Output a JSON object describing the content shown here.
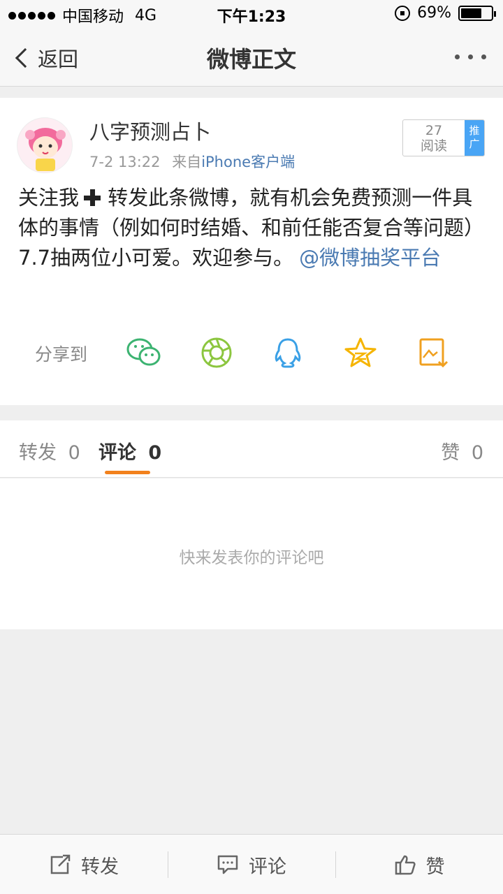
{
  "status_bar": {
    "carrier": "中国移动",
    "network": "4G",
    "time": "下午1:23",
    "battery": "69%",
    "battery_level": 0.69
  },
  "nav": {
    "back_label": "返回",
    "title": "微博正文"
  },
  "post": {
    "author": "八字预测占卜",
    "date": "7-2 13:22",
    "source_prefix": "来自",
    "source": "iPhone客户端",
    "read_count": "27",
    "read_label": "阅读",
    "promo_label": "推广",
    "text_part1": "关注我",
    "text_part2": " 转发此条微博，就有机会免费预测一件具体的事情（例如何时结婚、和前任能否复合等问题）7.7抽两位小可爱。欢迎参与。",
    "mention": "@微博抽奖平台"
  },
  "share": {
    "label": "分享到",
    "icons": [
      "wechat-icon",
      "moments-icon",
      "qq-icon",
      "qzone-icon",
      "save-image-icon"
    ],
    "colors": {
      "wechat": "#3cb371",
      "moments": "#8cc63f",
      "qq": "#3aa0e6",
      "qzone": "#f5b400",
      "save": "#f0a020"
    }
  },
  "tabs": [
    {
      "label": "转发",
      "count": "0"
    },
    {
      "label": "评论",
      "count": "0"
    },
    {
      "label": "赞",
      "count": "0"
    }
  ],
  "comments": {
    "empty_text": "快来发表你的评论吧"
  },
  "bottom_bar": {
    "repost": "转发",
    "comment": "评论",
    "like": "赞"
  },
  "colors": {
    "accent": "#f2811d",
    "link": "#4a7ab2",
    "promo": "#49a5f5"
  }
}
